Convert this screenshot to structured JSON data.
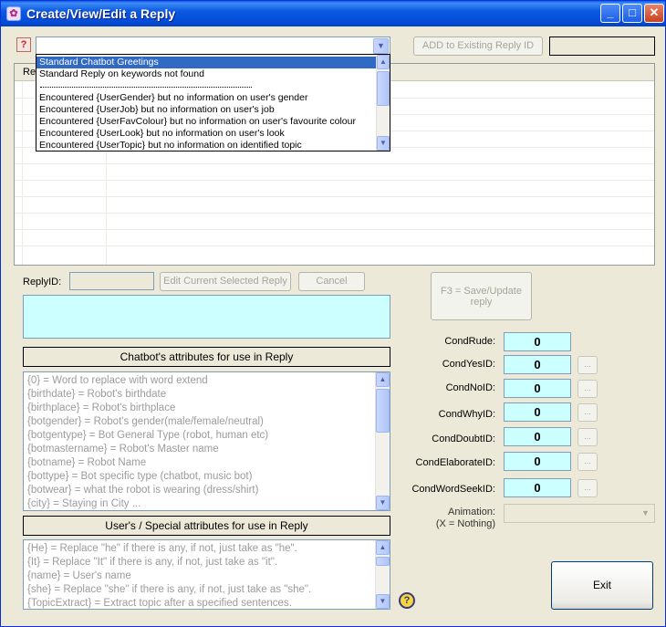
{
  "window": {
    "title": "Create/View/Edit a Reply",
    "controls": {
      "minimize": "_",
      "maximize": "□",
      "close": "✕"
    }
  },
  "toolbar": {
    "help_icon": "?",
    "add_button": "ADD to Existing Reply ID",
    "dropdown_arrow": "▼"
  },
  "dropdown": {
    "items": [
      "Standard Chatbot Greetings",
      "Standard Reply on keywords not found",
      "",
      "Encountered {UserGender} but no information on user's gender",
      "Encountered {UserJob} but no information on user's job",
      "Encountered {UserFavColour} but no information on user's favourite colour",
      "Encountered {UserLook} but no information on user's look",
      "Encountered {UserTopic} but no information on identified topic"
    ],
    "selected_index": 0
  },
  "grid": {
    "header_partial": "Re"
  },
  "reply": {
    "id_label": "ReplyID:",
    "edit_button": "Edit Current Selected Reply",
    "cancel_button": "Cancel",
    "save_button": "F3 = Save/Update reply"
  },
  "chatbot_attrs": {
    "title": "Chatbot's attributes for use in Reply",
    "lines": [
      "{0} = Word to replace with word extend",
      "{birthdate} = Robot's birthdate",
      "{birthplace} = Robot's birthplace",
      "{botgender} = Robot's gender(male/female/neutral)",
      "{botgentype} = Bot General Type (robot, human etc)",
      "{botmastername} = Robot's Master name",
      "{botname} = Robot Name",
      "{bottype} = Bot specific type (chatbot, music bot)",
      "{botwear} = what the robot is wearing (dress/shirt)",
      "{city} = Staying in City ..."
    ]
  },
  "user_attrs": {
    "title": "User's / Special attributes for use in Reply",
    "lines": [
      "{He} = Replace \"he\" if there is any, if not, just take as \"he\".",
      "{It} = Replace \"It\" if there is any, if not, just take as \"it\".",
      "{name} = User's name",
      "{she} = Replace \"she\" if there is any, if not, just take as \"she\".",
      "{TopicExtract} = Extract topic after a specified sentences."
    ]
  },
  "conditions": [
    {
      "label": "CondRude:",
      "value": "0",
      "has_button": false
    },
    {
      "label": "CondYesID:",
      "value": "0",
      "has_button": true
    },
    {
      "label": "CondNoID:",
      "value": "0",
      "has_button": true
    },
    {
      "label": "CondWhyID:",
      "value": "0",
      "has_button": true
    },
    {
      "label": "CondDoubtID:",
      "value": "0",
      "has_button": true
    },
    {
      "label": "CondElaborateID:",
      "value": "0",
      "has_button": true
    },
    {
      "label": "CondWordSeekID:",
      "value": "0",
      "has_button": true
    }
  ],
  "cond_button_label": "...",
  "animation": {
    "label": "Animation:",
    "sublabel": "(X = Nothing)"
  },
  "exit_button": "Exit",
  "help_circle": "?",
  "colors": {
    "title_blue": "#0449d6",
    "cyan_field": "#ccffff",
    "selection": "#316ac5"
  }
}
